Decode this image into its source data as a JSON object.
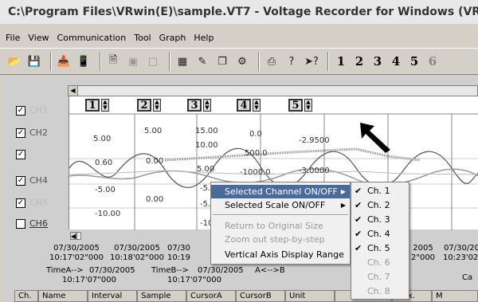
{
  "window": {
    "title": "C:\\Program Files\\VRwin(E)\\sample.VT7 - Voltage Recorder for Windows (VR-7)"
  },
  "menubar": [
    "File",
    "View",
    "Communication",
    "Tool",
    "Graph",
    "Help"
  ],
  "toolbar": {
    "channel_buttons": [
      "1",
      "2",
      "3",
      "4",
      "5",
      "6"
    ]
  },
  "channels": [
    {
      "name": "CH1",
      "checked": true,
      "ghost": true
    },
    {
      "name": "CH2",
      "checked": true,
      "ghost": false
    },
    {
      "name": "",
      "checked": true,
      "ghost": true
    },
    {
      "name": "CH4",
      "checked": true,
      "ghost": false
    },
    {
      "name": "CH5",
      "checked": true,
      "ghost": true
    },
    {
      "name": "CH6",
      "checked": false,
      "ghost": false
    }
  ],
  "graph": {
    "spinners": [
      "1",
      "2",
      "3",
      "4",
      "5"
    ],
    "scales": {
      "row1": [
        "5.00",
        "15.00",
        "0.0",
        "-2.9500"
      ],
      "row1b": [
        "5.00"
      ],
      "row2": [
        "10.00",
        "500.0"
      ],
      "row3": [
        "0.60",
        "0.00",
        "5.00",
        "-1000.0",
        "-3.0000"
      ],
      "row4": [
        "-5.00",
        "0.00",
        "-5.00"
      ],
      "row5": [
        "-10.00",
        "-5.0",
        "-10.0"
      ]
    }
  },
  "timeline": [
    {
      "date": "07/30/2005",
      "time": "10:17'02\"000"
    },
    {
      "date": "07/30/2005",
      "time": "10:18'02\"000"
    },
    {
      "date": "07/30",
      "time": "10:19"
    },
    {
      "date": "2005",
      "time": "2\"000"
    },
    {
      "date": "07/30/20",
      "time": "10:23'02'"
    }
  ],
  "cursor_info": {
    "time_a_label": "TimeA-->",
    "time_a_date": "07/30/2005",
    "time_a_time": "10:17'07\"000",
    "time_b_label": "TimeB-->",
    "time_b_date": "07/30/2005",
    "time_b_time": "10:17'07\"000",
    "diff_label": "A<-->B"
  },
  "corner_label": "Ca",
  "table_headers": [
    "Ch.",
    "Name",
    "Interval",
    "Sample",
    "CursorA",
    "CursorB",
    "Unit",
    "",
    "Max.",
    "M"
  ],
  "context_menu": [
    {
      "label": "Selected Channel ON/OFF",
      "submenu": true,
      "selected": true,
      "disabled": false
    },
    {
      "label": "Selected Scale ON/OFF",
      "submenu": true,
      "selected": false,
      "disabled": false
    },
    {
      "label": "Return to Original Size",
      "submenu": false,
      "selected": false,
      "disabled": true
    },
    {
      "label": "Zoom out step-by-step",
      "submenu": false,
      "selected": false,
      "disabled": true
    },
    {
      "label": "Vertical Axis Display Range",
      "submenu": false,
      "selected": false,
      "disabled": false
    }
  ],
  "submenu": [
    {
      "label": "Ch. 1",
      "checked": true,
      "disabled": false
    },
    {
      "label": "Ch. 2",
      "checked": true,
      "disabled": false
    },
    {
      "label": "Ch. 3",
      "checked": true,
      "disabled": false
    },
    {
      "label": "Ch. 4",
      "checked": true,
      "disabled": false
    },
    {
      "label": "Ch. 5",
      "checked": true,
      "disabled": false
    },
    {
      "label": "Ch. 6",
      "checked": false,
      "disabled": true
    },
    {
      "label": "Ch. 7",
      "checked": false,
      "disabled": true
    },
    {
      "label": "Ch. 8",
      "checked": false,
      "disabled": true
    }
  ]
}
